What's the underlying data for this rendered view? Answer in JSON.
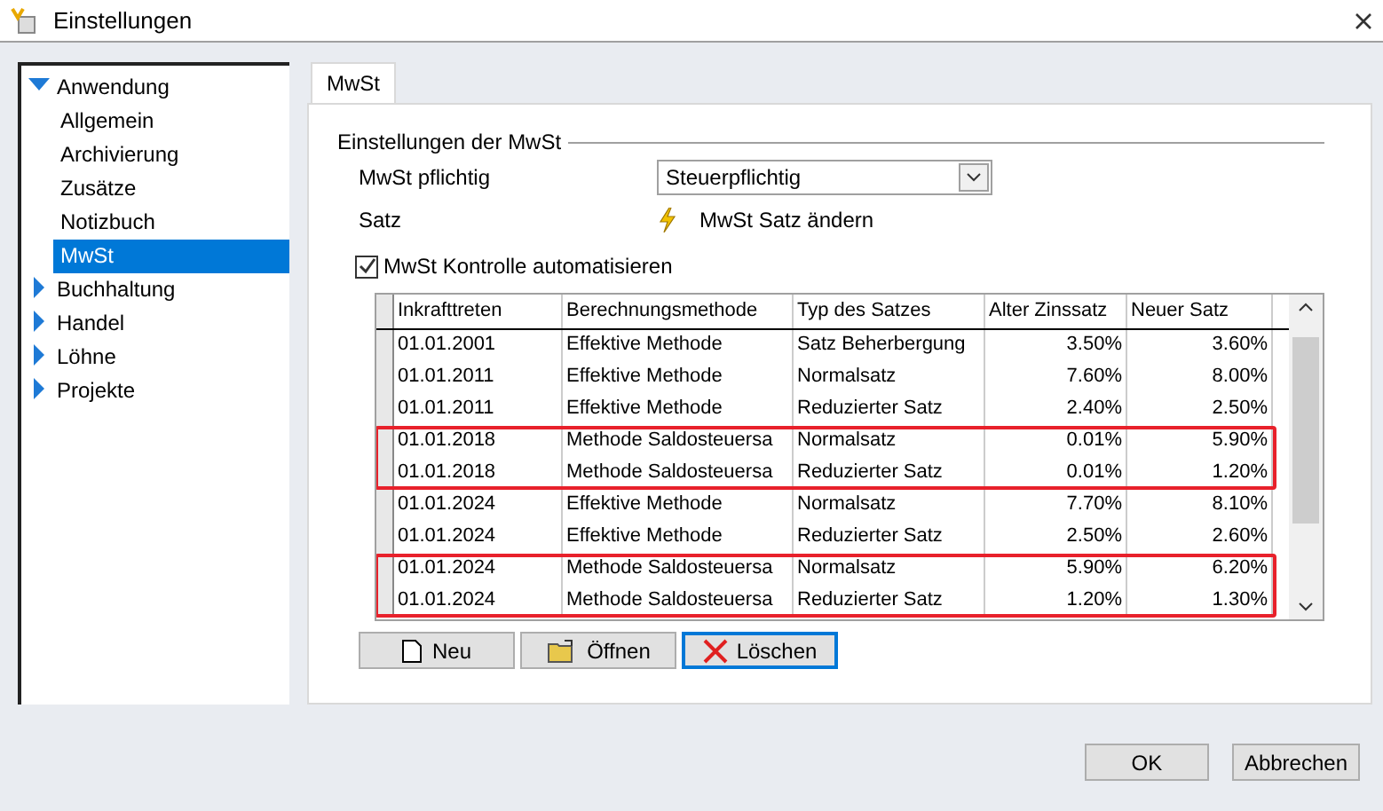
{
  "window": {
    "title": "Einstellungen"
  },
  "sidebar": {
    "items": [
      {
        "label": "Anwendung",
        "expanded": true,
        "selected": false,
        "children": [
          {
            "label": "Allgemein",
            "selected": false
          },
          {
            "label": "Archivierung",
            "selected": false
          },
          {
            "label": "Zusätze",
            "selected": false
          },
          {
            "label": "Notizbuch",
            "selected": false
          },
          {
            "label": "MwSt",
            "selected": true
          }
        ]
      },
      {
        "label": "Buchhaltung",
        "expanded": false,
        "selected": false
      },
      {
        "label": "Handel",
        "expanded": false,
        "selected": false
      },
      {
        "label": "Löhne",
        "expanded": false,
        "selected": false
      },
      {
        "label": "Projekte",
        "expanded": false,
        "selected": false
      }
    ]
  },
  "tabs": [
    {
      "label": "MwSt",
      "selected": true
    }
  ],
  "group": {
    "title": "Einstellungen der MwSt"
  },
  "mwst_pflichtig": {
    "label": "MwSt pflichtig",
    "value": "Steuerpflichtig"
  },
  "satz": {
    "label": "Satz",
    "action": "MwSt Satz ändern"
  },
  "auto_check": {
    "label": "MwSt Kontrolle automatisieren",
    "checked": true
  },
  "table": {
    "columns": [
      "Inkrafttreten",
      "Berechnungsmethode",
      "Typ des Satzes",
      "Alter Zinssatz",
      "Neuer Satz"
    ],
    "row_groups": [
      {
        "highlighted": false,
        "rows": [
          [
            "01.01.2001",
            "Effektive Methode",
            "Satz Beherbergung",
            "3.50%",
            "3.60%"
          ],
          [
            "01.01.2011",
            "Effektive Methode",
            "Normalsatz",
            "7.60%",
            "8.00%"
          ],
          [
            "01.01.2011",
            "Effektive Methode",
            "Reduzierter Satz",
            "2.40%",
            "2.50%"
          ]
        ]
      },
      {
        "highlighted": true,
        "rows": [
          [
            "01.01.2018",
            "Methode Saldosteuersa",
            "Normalsatz",
            "0.01%",
            "5.90%"
          ],
          [
            "01.01.2018",
            "Methode Saldosteuersa",
            "Reduzierter Satz",
            "0.01%",
            "1.20%"
          ]
        ]
      },
      {
        "highlighted": false,
        "rows": [
          [
            "01.01.2024",
            "Effektive Methode",
            "Normalsatz",
            "7.70%",
            "8.10%"
          ],
          [
            "01.01.2024",
            "Effektive Methode",
            "Reduzierter Satz",
            "2.50%",
            "2.60%"
          ]
        ]
      },
      {
        "highlighted": true,
        "rows": [
          [
            "01.01.2024",
            "Methode Saldosteuersa",
            "Normalsatz",
            "5.90%",
            "6.20%"
          ],
          [
            "01.01.2024",
            "Methode Saldosteuersa",
            "Reduzierter Satz",
            "1.20%",
            "1.30%"
          ]
        ]
      }
    ]
  },
  "table_buttons": [
    {
      "kind": "new",
      "label": "Neu",
      "focused": false
    },
    {
      "kind": "open",
      "label": "Öffnen",
      "focused": false
    },
    {
      "kind": "delete",
      "label": "Löschen",
      "focused": true
    }
  ],
  "footer_buttons": [
    "OK",
    "Abbrechen"
  ]
}
